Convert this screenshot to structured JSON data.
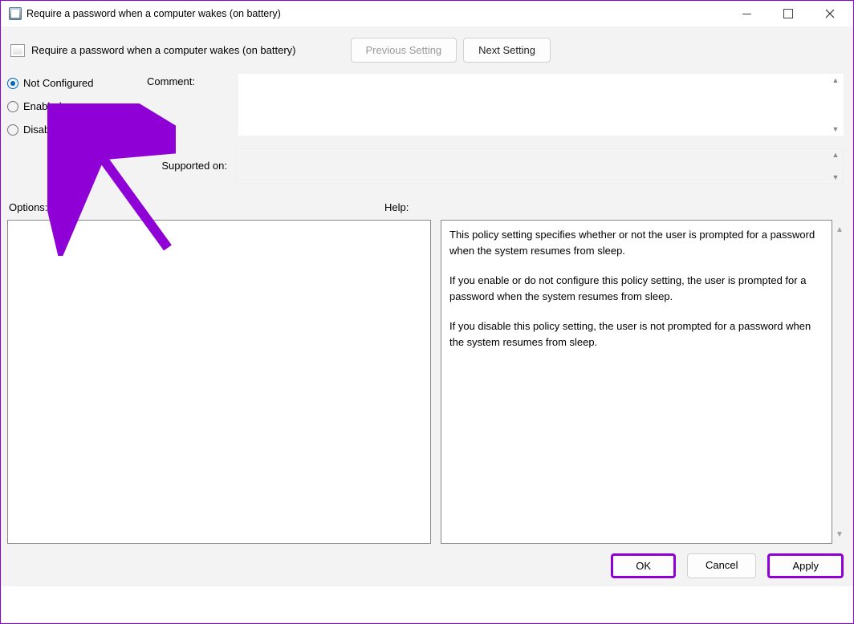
{
  "window_title": "Require a password when a computer wakes (on battery)",
  "policy_title": "Require a password when a computer wakes (on battery)",
  "nav": {
    "previous": "Previous Setting",
    "next": "Next Setting"
  },
  "state": {
    "not_configured": "Not Configured",
    "enabled": "Enabled",
    "disabled": "Disabled",
    "selected": "not_configured"
  },
  "labels": {
    "comment": "Comment:",
    "supported_on": "Supported on:",
    "options": "Options:",
    "help": "Help:"
  },
  "comment_value": "",
  "supported_on_value": "",
  "help": {
    "p1": "This policy setting specifies whether or not the user is prompted for a password when the system resumes from sleep.",
    "p2": "If you enable or do not configure this policy setting, the user is prompted for a password when the system resumes from sleep.",
    "p3": "If you disable this policy setting, the user is not prompted for a password when the system resumes from sleep."
  },
  "buttons": {
    "ok": "OK",
    "cancel": "Cancel",
    "apply": "Apply"
  }
}
